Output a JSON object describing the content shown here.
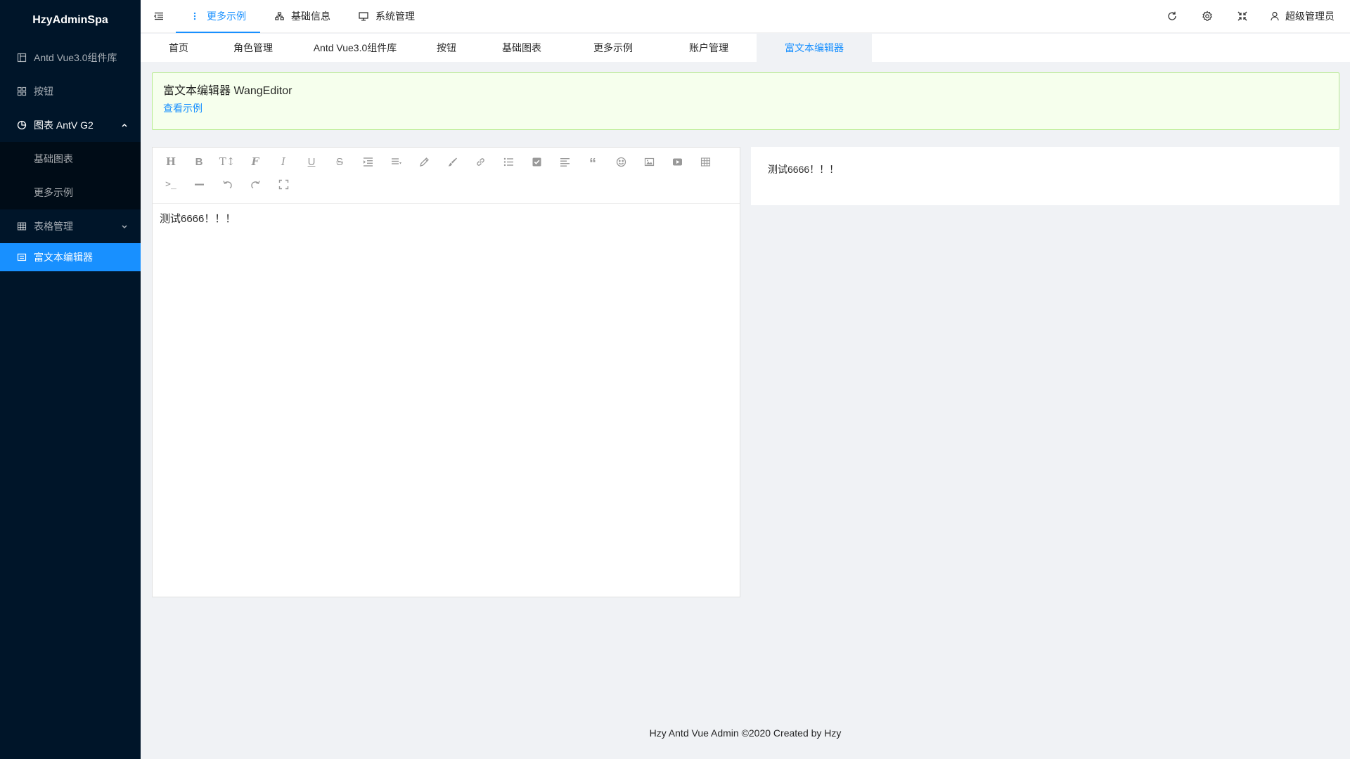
{
  "app": {
    "title": "HzyAdminSpa"
  },
  "sidebar": {
    "items": [
      {
        "label": "Antd Vue3.0组件库",
        "icon": "layout-icon"
      },
      {
        "label": "按钮",
        "icon": "appstore-icon"
      },
      {
        "label": "图表 AntV G2",
        "icon": "pie-chart-icon",
        "expanded": true,
        "children": [
          {
            "label": "基础图表"
          },
          {
            "label": "更多示例"
          }
        ]
      },
      {
        "label": "表格管理",
        "icon": "table-icon",
        "expanded": false
      },
      {
        "label": "富文本编辑器",
        "icon": "editor-icon",
        "active": true
      }
    ]
  },
  "header": {
    "menu": [
      {
        "label": "更多示例",
        "icon": "more-icon",
        "active": true
      },
      {
        "label": "基础信息",
        "icon": "cluster-icon"
      },
      {
        "label": "系统管理",
        "icon": "desktop-icon"
      }
    ],
    "user": "超级管理员"
  },
  "tabs": [
    {
      "label": "首页"
    },
    {
      "label": "角色管理"
    },
    {
      "label": "Antd Vue3.0组件库"
    },
    {
      "label": "按钮"
    },
    {
      "label": "基础图表"
    },
    {
      "label": "更多示例"
    },
    {
      "label": "账户管理"
    },
    {
      "label": "富文本编辑器",
      "active": true
    }
  ],
  "alert": {
    "title": "富文本编辑器 WangEditor",
    "link": "查看示例"
  },
  "editor": {
    "toolbar": [
      "heading",
      "bold",
      "font-size",
      "font-family",
      "italic",
      "underline",
      "strikethrough",
      "indent",
      "line-height",
      "fore-color",
      "back-color",
      "link",
      "list",
      "todo",
      "justify",
      "quote",
      "emoticon",
      "image",
      "video",
      "table",
      "code",
      "splitline",
      "undo",
      "redo",
      "fullscreen"
    ],
    "content": "测试6666！！！"
  },
  "preview": {
    "content": "测试6666！！！"
  },
  "footer": {
    "text": "Hzy Antd Vue Admin ©2020 Created by Hzy"
  },
  "colors": {
    "primary": "#1890ff",
    "sider": "#001529",
    "submenu": "#000c17",
    "alert_bg": "#f6ffed",
    "alert_border": "#b7eb8f"
  }
}
